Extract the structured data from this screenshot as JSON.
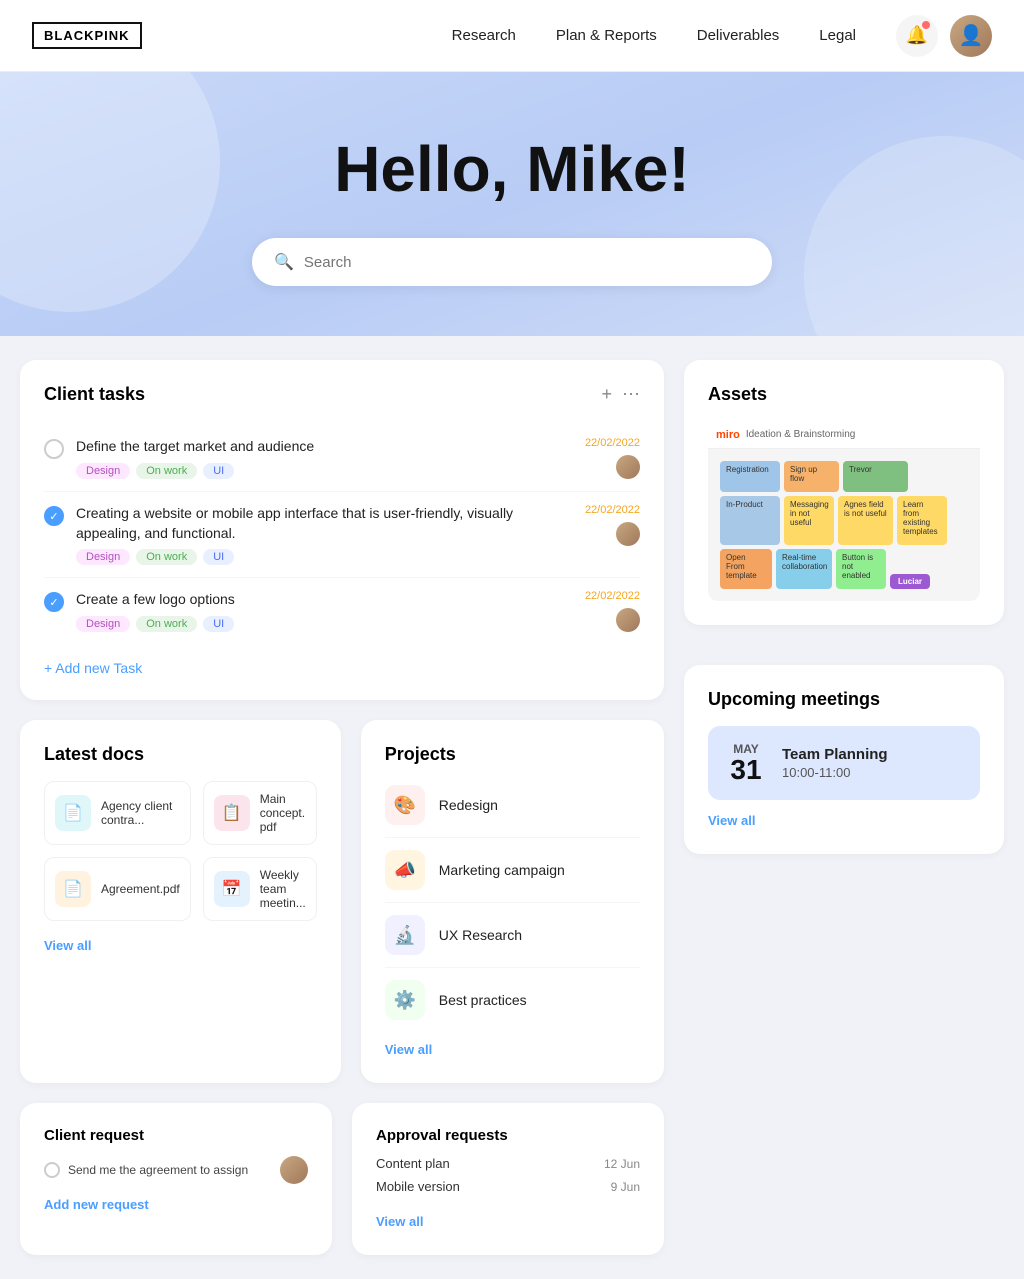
{
  "brand": {
    "name": "BLACKPINK"
  },
  "nav": {
    "links": [
      {
        "label": "Research",
        "id": "research"
      },
      {
        "label": "Plan & Reports",
        "id": "plan-reports"
      },
      {
        "label": "Deliverables",
        "id": "deliverables"
      },
      {
        "label": "Legal",
        "id": "legal"
      }
    ]
  },
  "hero": {
    "greeting": "Hello, Mike!",
    "search_placeholder": "Search"
  },
  "client_tasks": {
    "title": "Client tasks",
    "tasks": [
      {
        "id": "task-1",
        "text": "Define the target market and audience",
        "done": false,
        "tags": [
          "Design",
          "On work",
          "UI"
        ],
        "date": "22/02/2022"
      },
      {
        "id": "task-2",
        "text": "Creating a website or mobile app interface that is user-friendly, visually appealing, and functional.",
        "done": true,
        "tags": [
          "Design",
          "On work",
          "UI"
        ],
        "date": "22/02/2022"
      },
      {
        "id": "task-3",
        "text": "Create a few logo options",
        "done": true,
        "tags": [
          "Design",
          "On work",
          "UI"
        ],
        "date": "22/02/2022"
      }
    ],
    "add_label": "+ Add new Task"
  },
  "assets": {
    "title": "Assets"
  },
  "latest_docs": {
    "title": "Latest docs",
    "docs": [
      {
        "name": "Agency client contra...",
        "icon": "teal",
        "emoji": "📄"
      },
      {
        "name": "Main concept. pdf",
        "icon": "red",
        "emoji": "📋"
      },
      {
        "name": "Agreement.pdf",
        "icon": "orange",
        "emoji": "📄"
      },
      {
        "name": "Weekly team meetin...",
        "icon": "blue",
        "emoji": "📅"
      }
    ],
    "view_all": "View all"
  },
  "projects": {
    "title": "Projects",
    "items": [
      {
        "name": "Redesign",
        "icon": "🎨",
        "bg": "#fff0f0"
      },
      {
        "name": "Marketing campaign",
        "icon": "📣",
        "bg": "#fff5e0"
      },
      {
        "name": "UX Research",
        "icon": "🔬",
        "bg": "#f0f0ff"
      },
      {
        "name": "Best practices",
        "icon": "⚙️",
        "bg": "#f0fff0"
      }
    ],
    "view_all": "View all"
  },
  "upcoming_meetings": {
    "title": "Upcoming meetings",
    "meeting": {
      "month": "May",
      "day": "31",
      "title": "Team Planning",
      "time": "10:00-11:00"
    },
    "view_all": "View all"
  },
  "client_request": {
    "title": "Client request",
    "text": "Send me the agreement to assign",
    "add_label": "Add new request"
  },
  "approval_requests": {
    "title": "Approval requests",
    "items": [
      {
        "name": "Content plan",
        "date": "12 Jun"
      },
      {
        "name": "Mobile version",
        "date": "9 Jun"
      }
    ],
    "view_all": "View all"
  }
}
